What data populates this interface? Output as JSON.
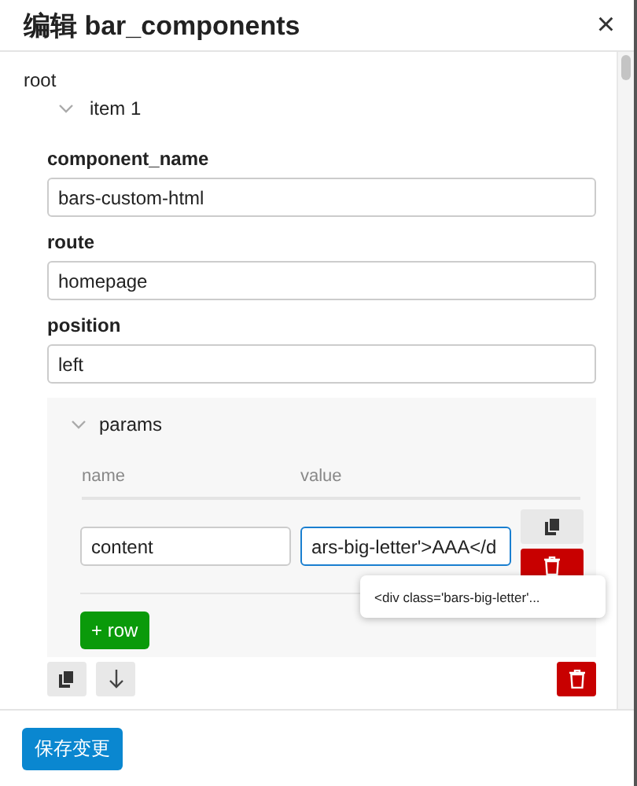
{
  "dialog": {
    "title": "编辑 bar_components",
    "close": "×"
  },
  "tree": {
    "root": "root",
    "item": {
      "label": "item 1",
      "expanded": true
    }
  },
  "fields": [
    {
      "label": "component_name",
      "value": "bars-custom-html"
    },
    {
      "label": "route",
      "value": "homepage"
    },
    {
      "label": "position",
      "value": "left"
    }
  ],
  "params": {
    "label": "params",
    "expanded": true,
    "columns": [
      "name",
      "value"
    ],
    "rows": [
      {
        "name": "content",
        "value": "ars-big-letter'>AAA</d",
        "focused": true
      }
    ],
    "add_button": "+ row"
  },
  "tooltip": "<div class='bars-big-letter'...",
  "footer": {
    "save_button": "保存变更"
  }
}
